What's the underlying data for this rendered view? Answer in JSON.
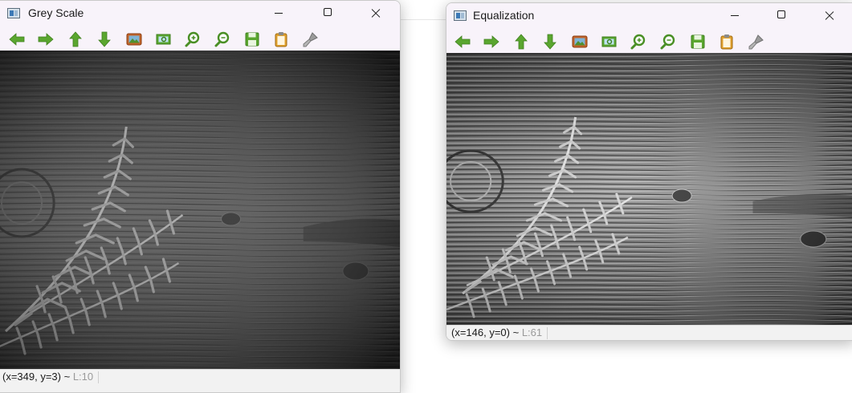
{
  "windows": [
    {
      "title": "Grey Scale",
      "status": {
        "coords": "(x=349, y=3) ~ ",
        "value": "L:10"
      },
      "image": "greyscale fern on wood"
    },
    {
      "title": "Equalization",
      "status": {
        "coords": "(x=146, y=0) ~ ",
        "value": "L:61"
      },
      "image": "equalized fern on wood"
    }
  ],
  "toolbar_icons": [
    "arrow-left-icon",
    "arrow-right-icon",
    "arrow-up-icon",
    "arrow-down-icon",
    "image-icon",
    "zoom-region-icon",
    "zoom-in-icon",
    "zoom-out-icon",
    "save-icon",
    "clipboard-icon",
    "brush-icon"
  ],
  "colors": {
    "icon_green": "#5aa62f",
    "titlebar": "#f8f3fa",
    "status_grey": "#9a9a9a"
  }
}
